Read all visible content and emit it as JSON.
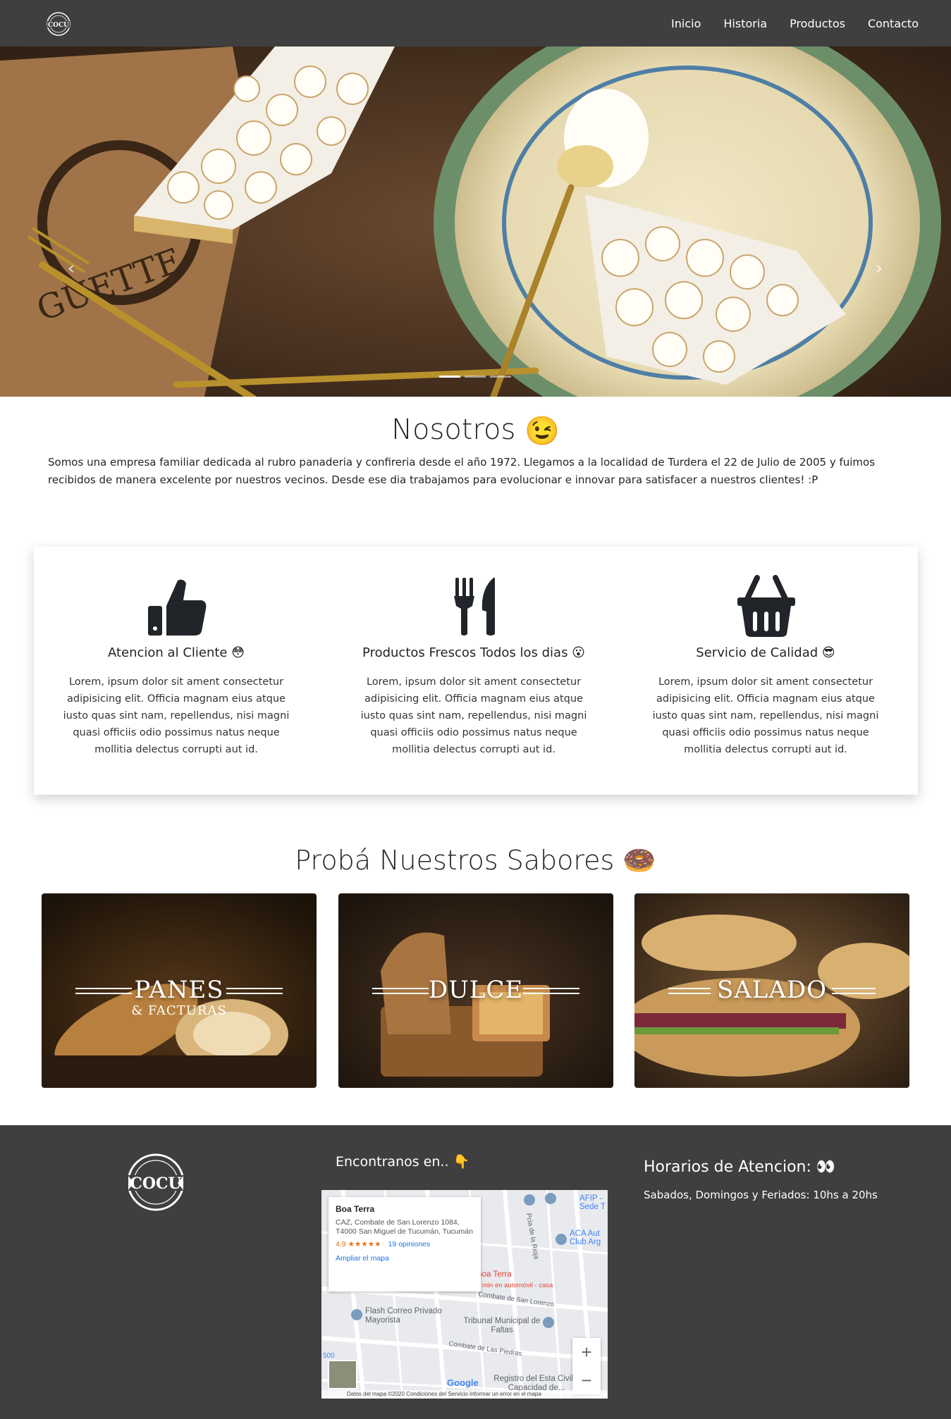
{
  "nav": {
    "logo_text": "COCU",
    "links": [
      "Inicio",
      "Historia",
      "Productos",
      "Contacto"
    ]
  },
  "hero": {
    "prev_arrow": "‹",
    "next_arrow": "›",
    "slide_count": 3,
    "active_slide": 1
  },
  "nosotros": {
    "title": "Nosotros",
    "title_emoji": "😉",
    "text": "Somos una empresa familiar dedicada al rubro panaderia y confireria desde el año 1972. Llegamos a la localidad de Turdera el 22 de Julio de 2005 y fuimos recibidos de manera excelente por nuestros vecinos. Desde ese dia trabajamos para evolucionar e innovar para satisfacer a nuestros clientes! :P"
  },
  "features": [
    {
      "icon": "thumbs-up-icon",
      "title": "Atencion al Cliente 😳",
      "text": "Lorem, ipsum dolor sit ament consectetur adipisicing elit. Officia magnam eius atque iusto quas sint nam, repellendus, nisi magni quasi officiis odio possimus natus neque mollitia delectus corrupti aut id."
    },
    {
      "icon": "utensils-icon",
      "title": "Productos Frescos Todos los dias 😮",
      "text": "Lorem, ipsum dolor sit ament consectetur adipisicing elit. Officia magnam eius atque iusto quas sint nam, repellendus, nisi magni quasi officiis odio possimus natus neque mollitia delectus corrupti aut id."
    },
    {
      "icon": "shopping-basket-icon",
      "title": "Servicio de Calidad 😎",
      "text": "Lorem, ipsum dolor sit ament consectetur adipisicing elit. Officia magnam eius atque iusto quas sint nam, repellendus, nisi magni quasi officiis odio possimus natus neque mollitia delectus corrupti aut id."
    }
  ],
  "sabores": {
    "title": "Probá Nuestros Sabores 🍩",
    "cards": [
      {
        "label": "PANES",
        "sublabel": "& FACTURAS"
      },
      {
        "label": "DULCE",
        "sublabel": ""
      },
      {
        "label": "SALADO",
        "sublabel": ""
      }
    ]
  },
  "footer": {
    "logo_text": "COCU",
    "find_label": "Encontranos en.. 👇",
    "map": {
      "place_name": "Boa Terra",
      "address": "CAZ, Combate de San Lorenzo 1084, T4000 San Miguel de Tucumán, Tucumán",
      "rating": "4.9 ★★★★★",
      "reviews": "19 opiniones",
      "enlarge_link": "Ampliar el mapa",
      "labels": [
        "AFIP - Sede T",
        "ACA Aut Club Arg",
        "Boa Terra",
        "min en automóvil - casa",
        "Combate de San Lorenzo",
        "Flash Correo Privado Mayorista",
        "Tribunal Municipal de Faltas",
        "Combate de Las Piedras",
        "Registro del Esta Civil y Capacidad de...",
        "Pcia de la Rioja",
        "Google",
        "500"
      ],
      "zoom_in": "+",
      "zoom_out": "−",
      "footer_text": "Datos del mapa ©2020   Condiciones del Servicio   Informar un error en el mapa"
    },
    "hours_title": "Horarios de Atencion: 👀",
    "hours_text": "Sabados, Domingos y Feriados: 10hs a 20hs"
  },
  "colors": {
    "navbar": "#3f3f3f",
    "footer": "#3f3f3f",
    "text": "#212529",
    "link": "#1a73e8"
  }
}
